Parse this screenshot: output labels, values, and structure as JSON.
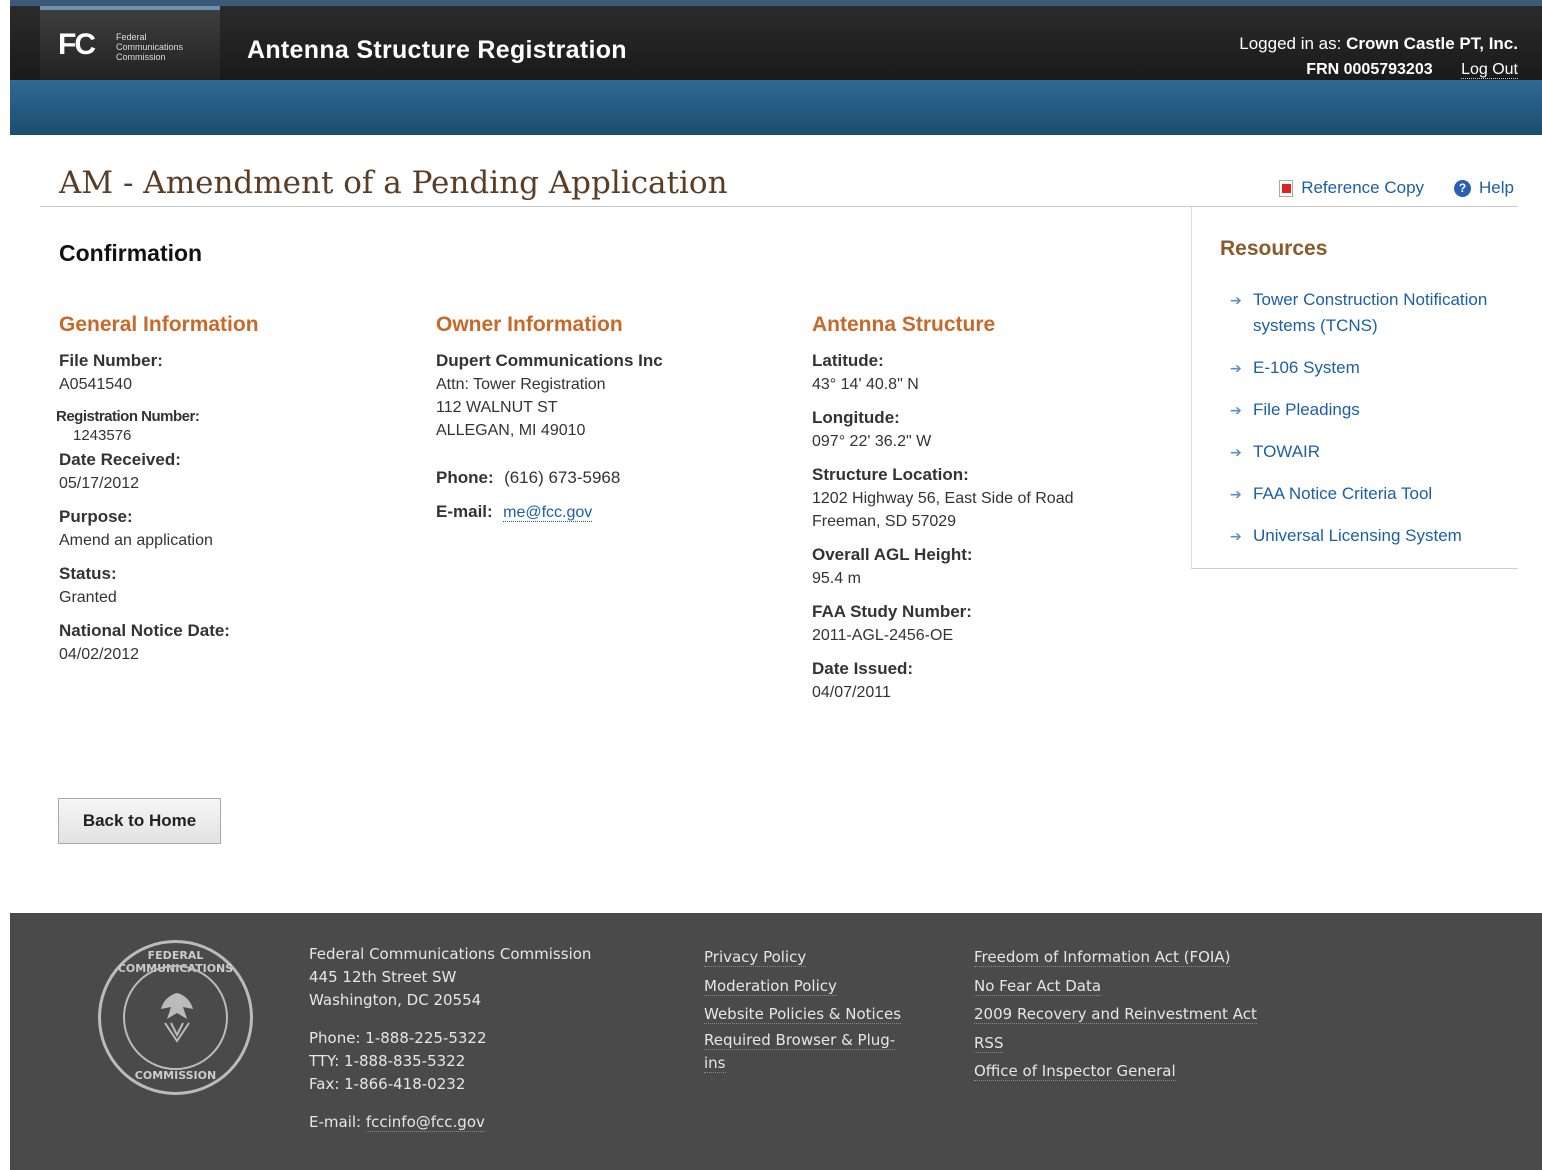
{
  "header": {
    "logo_mark": "FC",
    "logo_text_1": "Federal",
    "logo_text_2": "Communications",
    "logo_text_3": "Commission",
    "app_title": "Antenna Structure Registration",
    "logged_in_prefix": "Logged in as: ",
    "logged_in_name": "Crown Castle PT, Inc.",
    "frn": "FRN 0005793203",
    "logout": "Log Out"
  },
  "page": {
    "title": "AM - Amendment of a Pending Application",
    "reference_copy": "Reference Copy",
    "help": "Help",
    "confirmation": "Confirmation",
    "back_button": "Back to Home"
  },
  "general": {
    "heading": "General Information",
    "file_number_label": "File Number:",
    "file_number": "A0541540",
    "registration_number_label": "Registration Number:",
    "registration_number": "1243576",
    "date_received_label": "Date Received:",
    "date_received": "05/17/2012",
    "purpose_label": "Purpose:",
    "purpose": "Amend an application",
    "status_label": "Status:",
    "status": "Granted",
    "national_notice_label": "National Notice Date:",
    "national_notice": "04/02/2012"
  },
  "owner": {
    "heading": "Owner Information",
    "name": "Dupert Communications Inc",
    "attn": "Attn: Tower Registration",
    "street": "112 WALNUT ST",
    "city": "ALLEGAN, MI 49010",
    "phone_label": "Phone:",
    "phone": "(616) 673-5968",
    "email_label": "E-mail:",
    "email": "me@fcc.gov"
  },
  "antenna": {
    "heading": "Antenna Structure",
    "latitude_label": "Latitude:",
    "latitude": "43° 14' 40.8\" N",
    "longitude_label": "Longitude:",
    "longitude": "097° 22' 36.2\" W",
    "location_label": "Structure Location:",
    "location_line1": "1202 Highway 56, East Side of Road",
    "location_line2": "Freeman, SD 57029",
    "agl_label": "Overall AGL Height:",
    "agl": "95.4 m",
    "faa_label": "FAA Study Number:",
    "faa": "2011-AGL-2456-OE",
    "issued_label": "Date Issued:",
    "issued": "04/07/2011"
  },
  "resources": {
    "heading": "Resources",
    "items": [
      {
        "label": "Tower Construction Notification systems (TCNS)"
      },
      {
        "label": "E-106 System"
      },
      {
        "label": "File Pleadings"
      },
      {
        "label": "TOWAIR"
      },
      {
        "label": "FAA Notice Criteria Tool"
      },
      {
        "label": "Universal Licensing System"
      }
    ]
  },
  "footer": {
    "seal_top": "FEDERAL COMMUNICATIONS",
    "seal_bottom": "COMMISSION",
    "org": "Federal Communications Commission",
    "street": "445 12th Street SW",
    "city": "Washington, DC 20554",
    "phone": "Phone: 1-888-225-5322",
    "tty": "TTY: 1-888-835-5322",
    "fax": "Fax: 1-866-418-0232",
    "email_prefix": "E-mail: ",
    "email": "fccinfo@fcc.gov",
    "links_col1": [
      "Privacy Policy",
      "Moderation Policy",
      "Website Policies & Notices",
      "Required Browser & Plug-",
      "ins"
    ],
    "links_col2": [
      "Freedom of Information Act (FOIA)",
      "No Fear Act Data",
      "2009 Recovery and Reinvestment Act",
      "RSS",
      "Office of Inspector General"
    ]
  }
}
